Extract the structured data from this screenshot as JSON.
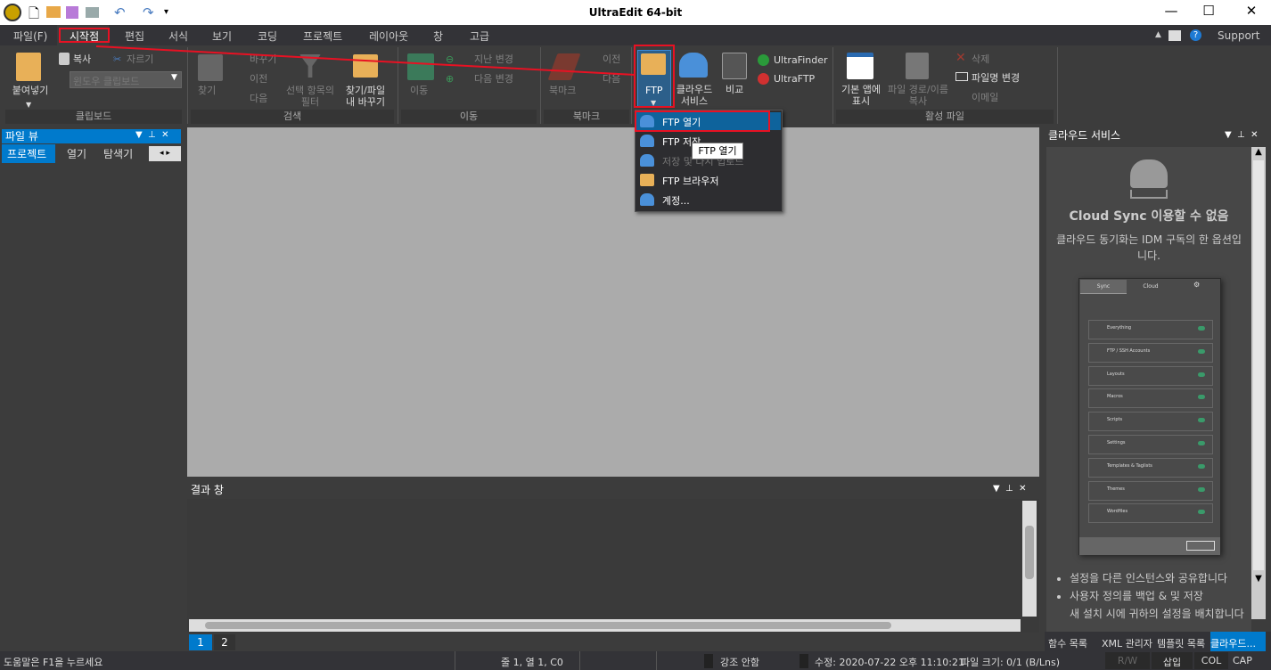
{
  "window": {
    "title": "UltraEdit 64-bit",
    "minimize": "—",
    "maximize": "☐",
    "close": "✕"
  },
  "quick_access": [
    "app-logo-icon",
    "new-file-icon",
    "open-folder-icon",
    "save-icon",
    "print-icon",
    "undo-icon",
    "redo-icon",
    "customize-icon"
  ],
  "menu": {
    "tabs": [
      "파일(F)",
      "시작점",
      "편집",
      "서식",
      "보기",
      "코딩",
      "프로젝트",
      "레이아웃",
      "창",
      "고급"
    ],
    "active": "시작점",
    "support": "Support"
  },
  "ribbon": {
    "clipboard": {
      "paste": "붙여넣기",
      "copy": "복사",
      "cut": "자르기",
      "clipboard_select": "윈도우 클립보드",
      "label": "클립보드"
    },
    "search": {
      "find": "찾기",
      "replace": "바꾸기",
      "prev": "이전",
      "next": "다음",
      "filter": "선택 항목의 필터",
      "find_in_files": "찾기/파일 내 바꾸기",
      "label": "검색"
    },
    "navigate": {
      "goto": "이동",
      "prev_change": "지난 변경",
      "next_change": "다음 변경",
      "label": "이동"
    },
    "bookmark": {
      "bookmark": "북마크",
      "prev": "이전",
      "next": "다음",
      "label": "북마크"
    },
    "ftp": {
      "ftp": "FTP",
      "cloud": "클라우드 서비스",
      "compare": "비교",
      "ultrafinder": "UltraFinder",
      "ultraftp": "UltraFTP"
    },
    "active_file": {
      "show_default_app": "기본 앱에 표시",
      "copy_path": "파일 경로/이름 복사",
      "delete": "삭제",
      "rename": "파일명 변경",
      "email": "이메일",
      "label": "활성 파일"
    }
  },
  "ftp_menu": {
    "items": [
      {
        "label": "FTP 열기",
        "enabled": true,
        "highlighted": true
      },
      {
        "label": "FTP 저장",
        "enabled": true
      },
      {
        "label": "저장 및 다시 업로드",
        "enabled": false
      },
      {
        "label": "FTP 브라우저",
        "enabled": true
      },
      {
        "label": "계정...",
        "enabled": true
      }
    ],
    "tooltip": "FTP 열기"
  },
  "file_view": {
    "title": "파일 뷰",
    "tabs": [
      "프로젝트",
      "열기",
      "탐색기"
    ],
    "active": "프로젝트"
  },
  "results": {
    "title": "결과 창",
    "tabs": [
      "1",
      "2"
    ],
    "active": "1"
  },
  "cloud_panel": {
    "title": "클라우드 서비스",
    "heading": "Cloud Sync 이용할 수 없음",
    "description": "클라우드 동기화는 IDM 구독의 한 옵션입니다.",
    "sync_preview": {
      "tabs": [
        "Sync",
        "Cloud"
      ],
      "items": [
        "Everything",
        "FTP / SSH Accounts",
        "Layouts",
        "Macros",
        "Scripts",
        "Settings",
        "Templates & Taglists",
        "Themes",
        "Wordfiles"
      ]
    },
    "bullets": [
      "설정을 다른 인스턴스와 공유합니다",
      "사용자 정의를 백업 & 및 저장",
      "새 설치 시에 귀하의 설정을 배치합니다"
    ]
  },
  "bottom_tabs": {
    "items": [
      "함수 목록",
      "XML 관리자",
      "템플릿 목록",
      "클라우드..."
    ],
    "active": "클라우드..."
  },
  "status": {
    "help": "도움말은 F1을 누르세요",
    "position": "줄 1, 열 1, C0",
    "highlight": "강조 안함",
    "modified": "수정: 2020-07-22 오후 11:10:21",
    "file_size": "파일 크기: 0/1 (B/Lns)",
    "rw": "R/W",
    "insert": "삽입",
    "col": "COL",
    "cap": "CAP"
  },
  "colors": {
    "accent": "#007acc",
    "annotation": "#e81123",
    "editor_bg": "#ababab"
  }
}
